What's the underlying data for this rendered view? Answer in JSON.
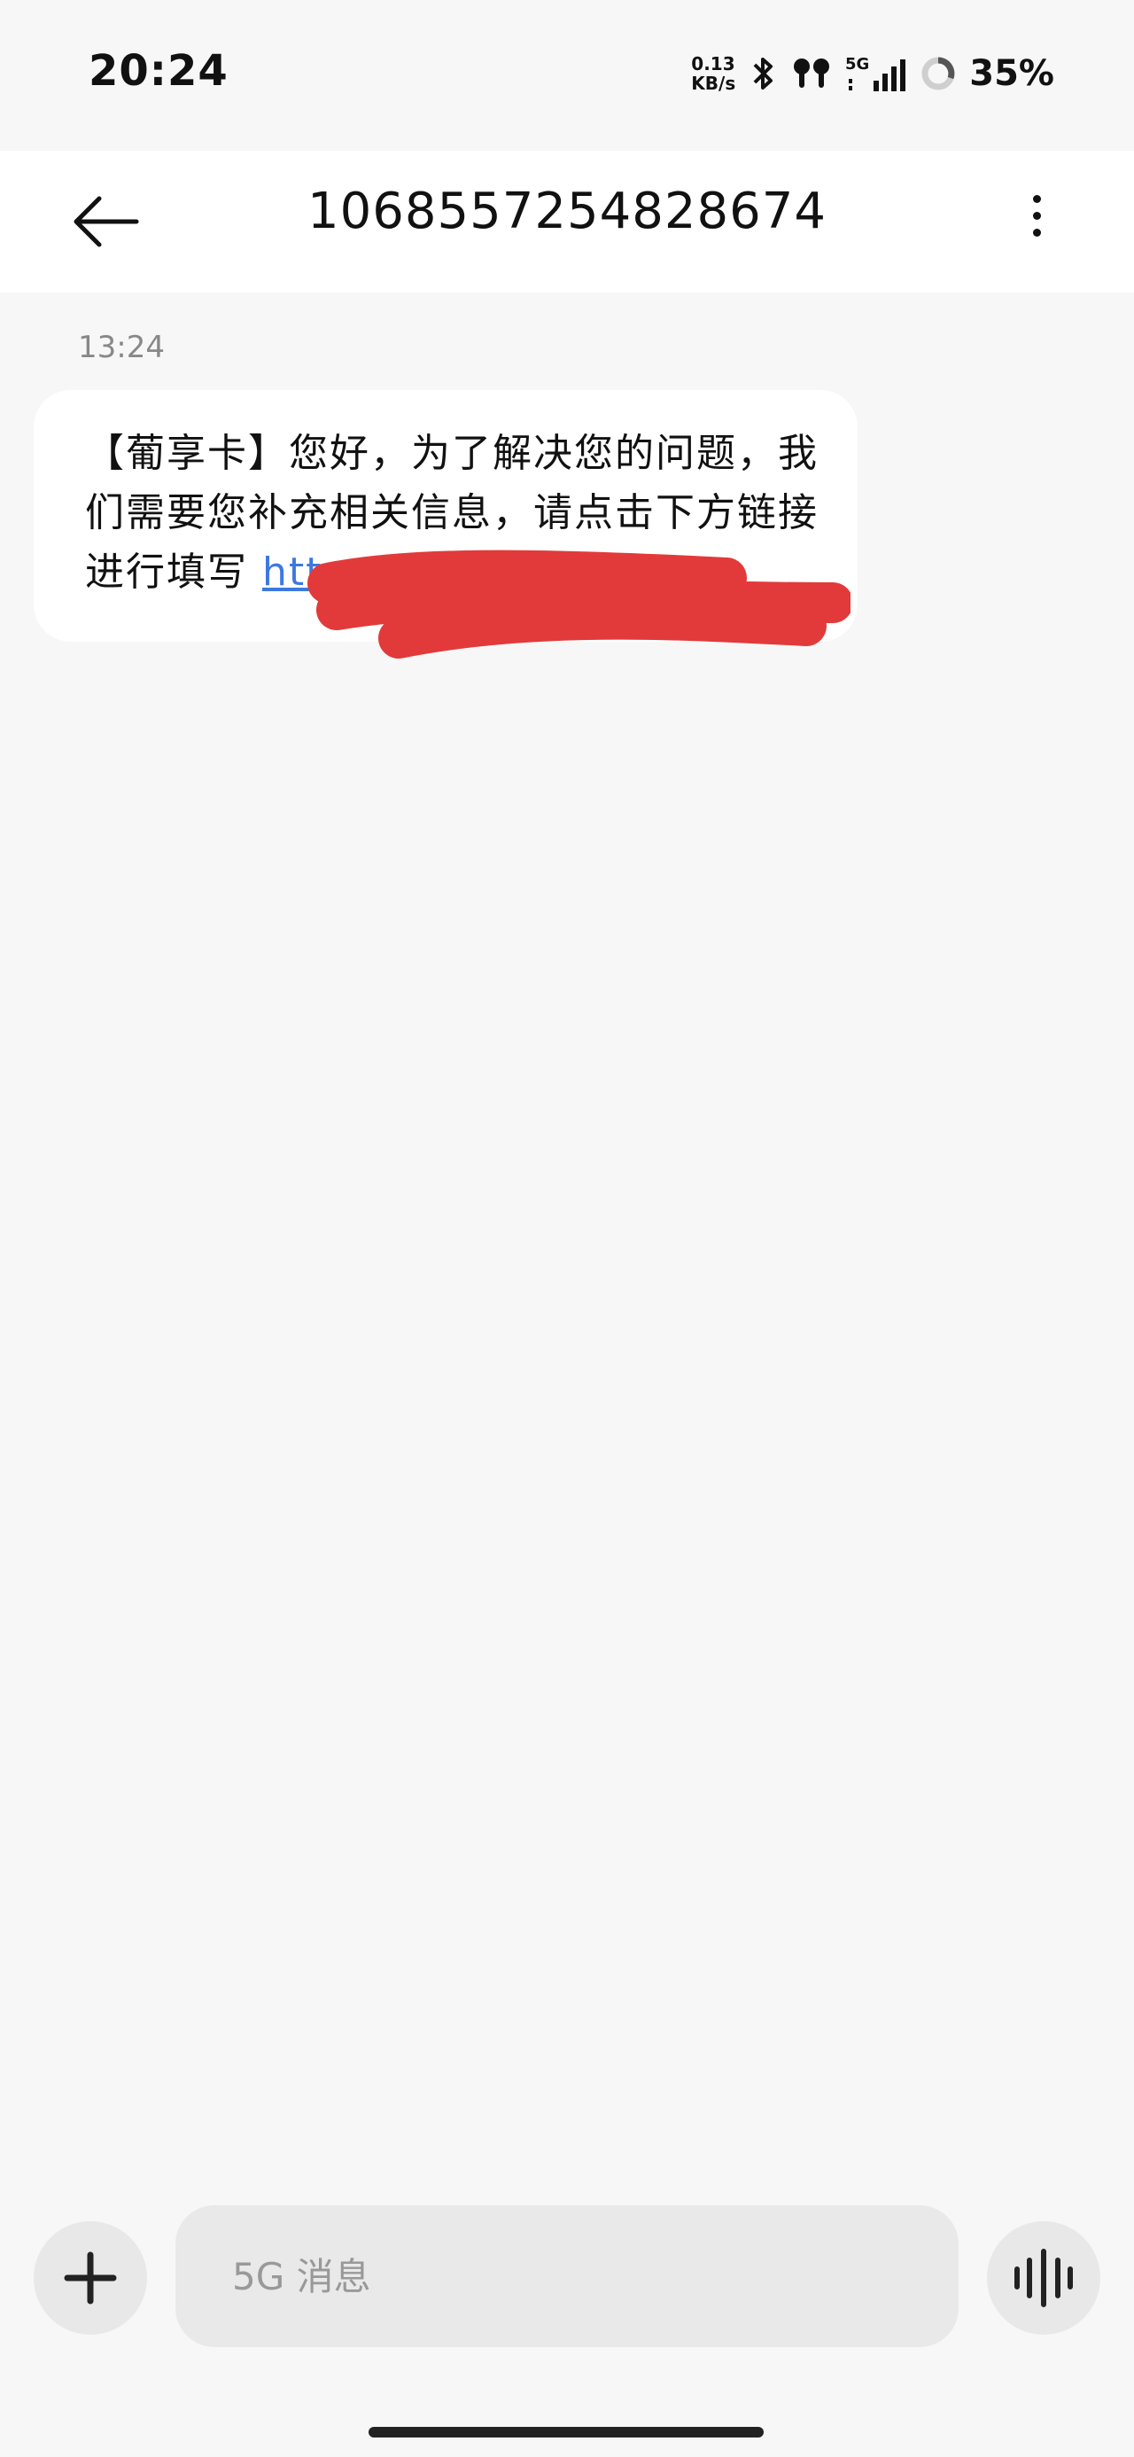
{
  "status_bar": {
    "time": "20:24",
    "net_speed_value": "0.13",
    "net_speed_unit": "KB/s",
    "network_type": "5G",
    "battery_percent": "35%"
  },
  "header": {
    "title": "1068557254828674"
  },
  "conversation": {
    "messages": [
      {
        "time": "13:24",
        "text": "【葡享卡】您好，为了解决您的问题，我们需要您补充相关信息，请点击下方链接进行填写 ",
        "link_visible": "https://"
      }
    ]
  },
  "composer": {
    "placeholder": "5G 消息"
  },
  "colors": {
    "accent_link": "#3d78e0",
    "redaction": "#e23a3a"
  }
}
